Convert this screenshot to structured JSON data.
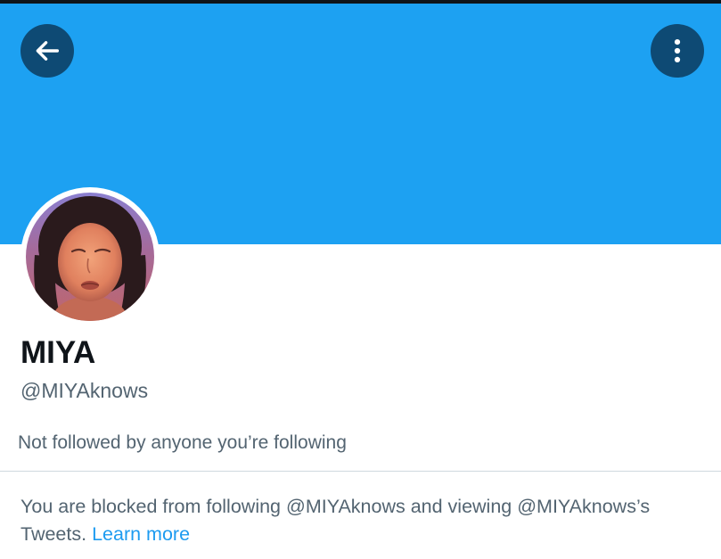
{
  "header": {
    "back_icon": "arrow-left-icon",
    "more_icon": "vertical-ellipsis-icon",
    "banner_color": "#1da1f2",
    "button_color": "#0e4a74"
  },
  "profile": {
    "name": "MIYA",
    "handle": "@MIYAknows",
    "followed_by": "Not followed by anyone you’re following"
  },
  "blocked_notice": {
    "text": "You are blocked from following @MIYAknows and viewing @MIYAknows’s Tweets.",
    "link": "Learn more",
    "link_color": "#1d9bf0"
  }
}
